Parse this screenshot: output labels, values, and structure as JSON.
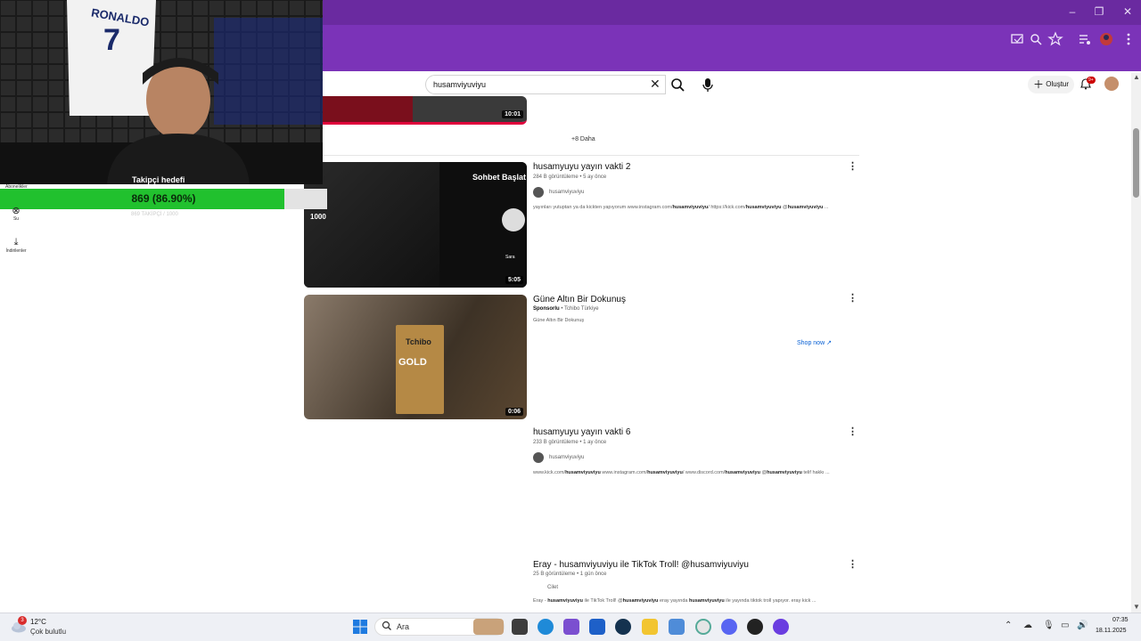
{
  "browser": {
    "window_controls": [
      "–",
      "❐",
      "✕"
    ],
    "toolbar_icons": [
      "cast-icon",
      "zoom-icon",
      "star-icon",
      "media-icon",
      "profile-icon",
      "menu-icon"
    ]
  },
  "youtube": {
    "search_value": "husamviyuviyu",
    "create_label": "Oluştur",
    "notification_badge": "9+",
    "more_label": "+8 Daha",
    "videos": [
      {
        "duration": "10:01"
      },
      {
        "title": "husamyuyu yayın vakti 2",
        "meta": "284 B görüntüleme • 5 ay önce",
        "channel": "husamviyuviyu",
        "desc_parts": [
          "yayınları yutuptan ya da kickten yapıyorum www.instagram.com/",
          "husamviyuviyu",
          "/ https://kick.com/",
          "husamviyuviyu",
          " @",
          "husamviyuviyu",
          " ..."
        ],
        "duration": "5:05",
        "thumb_text": "Sohbet Başlat",
        "thumb_count": "1000",
        "thumb_name": "Sara"
      },
      {
        "title": "Güne Altın Bir Dokunuş",
        "sponsor_label": "Sponsorlu",
        "sponsor_name": "Tchibo Türkiye",
        "desc": "Güne Altın Bir Dokunuş",
        "shop_label": "Shop now",
        "duration": "0:06",
        "pack_brand": "Tchibo",
        "pack_product": "GOLD"
      },
      {
        "title": "husamyuyu yayın vakti 6",
        "meta": "233 B görüntüleme • 1 ay önce",
        "channel": "husamviyuviyu",
        "desc_parts": [
          "www.kick.com/",
          "husamviyuviyu",
          " www.instagram.com/",
          "husamviyuviyu",
          "/ www.discord.com/",
          "husamviyuviyu",
          " @",
          "husamviyuviyu",
          " telif hakkı ..."
        ]
      },
      {
        "title": "Eray - husamviyuviyu ile TikTok Troll! @husamviyuviyu",
        "meta": "25 B görüntüleme • 1 gün önce",
        "channel": "Cilet",
        "desc_parts": [
          "Eray - ",
          "husamviyuviyu",
          " ile TikTok Troll! @",
          "husamviyuviyu",
          " eray yayında ",
          "husamviyuviyu",
          " ile yayında tiktok troll yapıyor. eray kick ..."
        ]
      }
    ]
  },
  "overlay": {
    "goal_label": "Takipçi hedefi",
    "progress_text": "869 (86.90%)",
    "progress_fraction": 0.869,
    "progress_sub": "869 TAKİPÇİ / 1000",
    "jersey_name": "RONALDO",
    "jersey_number": "7",
    "small_label": "Abonelikler",
    "side_items": [
      {
        "icon": "close-circle-icon",
        "label": "Su"
      },
      {
        "icon": "download-icon",
        "label": "İndirilenler"
      }
    ]
  },
  "taskbar": {
    "weather_badge": "3",
    "temperature": "12°C",
    "weather_desc": "Çok bulutlu",
    "search_label": "Ara",
    "time": "07:35",
    "date": "18.11.2025"
  }
}
